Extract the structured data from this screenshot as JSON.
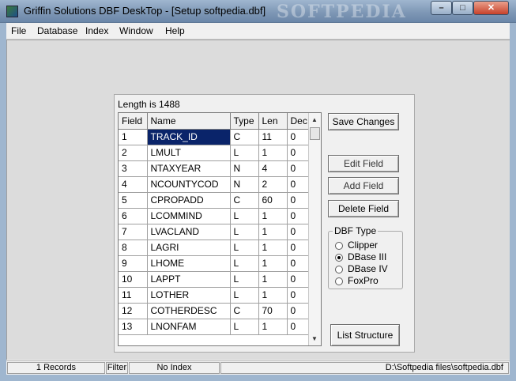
{
  "window": {
    "title": "Griffin Solutions DBF DeskTop - [Setup softpedia.dbf]",
    "watermark": "SOFTPEDIA",
    "controls": {
      "minimize": "–",
      "maximize": "□",
      "close": "✕"
    }
  },
  "menu": [
    "File",
    "Database",
    "Index",
    "Window",
    "Help"
  ],
  "dialog": {
    "length_label": "Length is 1488",
    "columns": [
      "Field",
      "Name",
      "Type",
      "Len",
      "Dec"
    ],
    "rows": [
      [
        "1",
        "TRACK_ID",
        "C",
        "11",
        "0"
      ],
      [
        "2",
        "LMULT",
        "L",
        "1",
        "0"
      ],
      [
        "3",
        "NTAXYEAR",
        "N",
        "4",
        "0"
      ],
      [
        "4",
        "NCOUNTYCOD",
        "N",
        "2",
        "0"
      ],
      [
        "5",
        "CPROPADD",
        "C",
        "60",
        "0"
      ],
      [
        "6",
        "LCOMMIND",
        "L",
        "1",
        "0"
      ],
      [
        "7",
        "LVACLAND",
        "L",
        "1",
        "0"
      ],
      [
        "8",
        "LAGRI",
        "L",
        "1",
        "0"
      ],
      [
        "9",
        "LHOME",
        "L",
        "1",
        "0"
      ],
      [
        "10",
        "LAPPT",
        "L",
        "1",
        "0"
      ],
      [
        "11",
        "LOTHER",
        "L",
        "1",
        "0"
      ],
      [
        "12",
        "COTHERDESC",
        "C",
        "70",
        "0"
      ],
      [
        "13",
        "LNONFAM",
        "L",
        "1",
        "0"
      ]
    ],
    "selected_row": 0,
    "buttons": {
      "save_changes": "Save Changes",
      "edit_field": "Edit Field",
      "add_field": "Add Field",
      "delete_field": "Delete Field",
      "list_structure": "List Structure"
    },
    "dbf_type": {
      "title": "DBF Type",
      "options": [
        "Clipper",
        "DBase III",
        "DBase IV",
        "FoxPro"
      ],
      "selected": "DBase III"
    }
  },
  "status": {
    "records": "1 Records",
    "filter": "Filter",
    "index": "No Index",
    "path": "D:\\Softpedia files\\softpedia.dbf"
  },
  "colors": {
    "selection": "#0a246a",
    "titlebar": "#7f98b6"
  },
  "icons": [
    "app-icon",
    "scroll-up-icon",
    "scroll-down-icon"
  ]
}
